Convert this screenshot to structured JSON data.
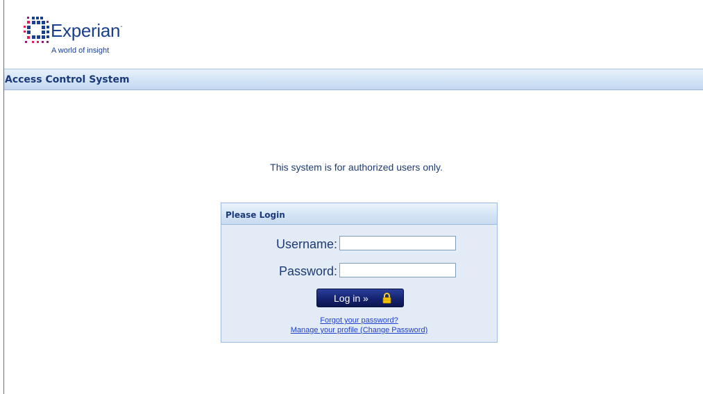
{
  "brand": {
    "name": "Experian",
    "trademark": "-",
    "tagline": "A world of insight",
    "color": "#1a3f8f",
    "dot_colors": [
      "#1a3f8f",
      "#e31b5a",
      "#8a1f7a"
    ]
  },
  "header": {
    "title": "Access Control System"
  },
  "notice": {
    "text": "This system is for authorized users only."
  },
  "login": {
    "panel_title": "Please Login",
    "username_label": "Username:",
    "username_value": "",
    "password_label": "Password:",
    "password_value": "",
    "button_label": "Log in »",
    "button_icon": "lock-icon",
    "forgot_link": "Forgot your password?",
    "manage_link": "Manage your profile (Change Password)"
  }
}
